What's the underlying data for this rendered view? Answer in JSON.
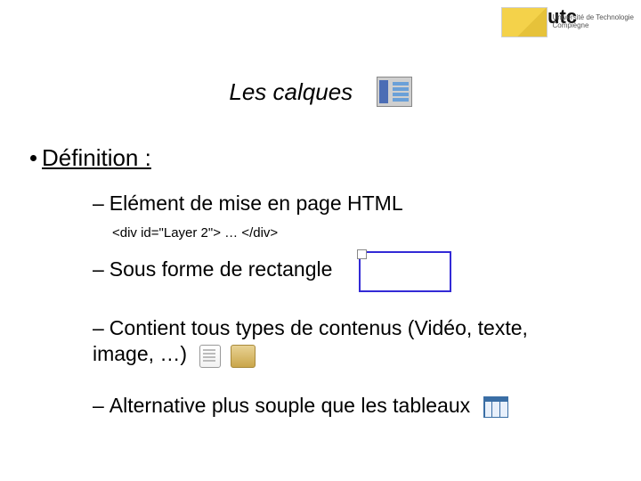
{
  "header": {
    "logo_text_line1": "Université de Technologie",
    "logo_text_line2": "Compiègne",
    "logo_word": "utc"
  },
  "title": "Les calques",
  "bullet": {
    "label": "Définition :"
  },
  "items": {
    "i1": "Elément de mise en page HTML",
    "i1_code": "<div id=\"Layer 2\"> … </div>",
    "i2": "Sous forme de rectangle",
    "i3": "Contient tous types de contenus (Vidéo, texte, image, …)",
    "i4": "Alternative plus souple que les tableaux"
  },
  "dash": "–"
}
